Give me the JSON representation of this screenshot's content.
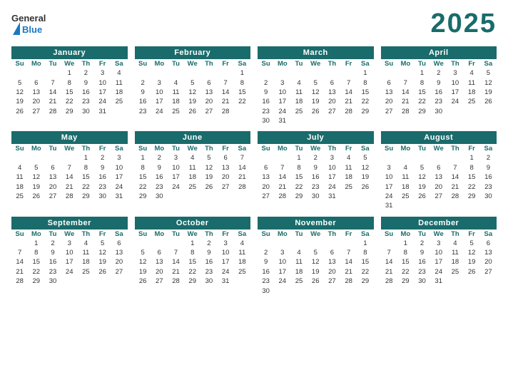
{
  "year": "2025",
  "logo": {
    "general": "General",
    "blue": "Blue"
  },
  "days_header": [
    "Su",
    "Mo",
    "Tu",
    "We",
    "Th",
    "Fr",
    "Sa"
  ],
  "months": [
    {
      "name": "January",
      "weeks": [
        [
          "",
          "",
          "",
          "1",
          "2",
          "3",
          "4"
        ],
        [
          "5",
          "6",
          "7",
          "8",
          "9",
          "10",
          "11"
        ],
        [
          "12",
          "13",
          "14",
          "15",
          "16",
          "17",
          "18"
        ],
        [
          "19",
          "20",
          "21",
          "22",
          "23",
          "24",
          "25"
        ],
        [
          "26",
          "27",
          "28",
          "29",
          "30",
          "31",
          ""
        ]
      ]
    },
    {
      "name": "February",
      "weeks": [
        [
          "",
          "",
          "",
          "",
          "",
          "",
          "1"
        ],
        [
          "2",
          "3",
          "4",
          "5",
          "6",
          "7",
          "8"
        ],
        [
          "9",
          "10",
          "11",
          "12",
          "13",
          "14",
          "15"
        ],
        [
          "16",
          "17",
          "18",
          "19",
          "20",
          "21",
          "22"
        ],
        [
          "23",
          "24",
          "25",
          "26",
          "27",
          "28",
          ""
        ]
      ]
    },
    {
      "name": "March",
      "weeks": [
        [
          "",
          "",
          "",
          "",
          "",
          "",
          "1"
        ],
        [
          "2",
          "3",
          "4",
          "5",
          "6",
          "7",
          "8"
        ],
        [
          "9",
          "10",
          "11",
          "12",
          "13",
          "14",
          "15"
        ],
        [
          "16",
          "17",
          "18",
          "19",
          "20",
          "21",
          "22"
        ],
        [
          "23",
          "24",
          "25",
          "26",
          "27",
          "28",
          "29"
        ],
        [
          "30",
          "31",
          "",
          "",
          "",
          "",
          ""
        ]
      ]
    },
    {
      "name": "April",
      "weeks": [
        [
          "",
          "",
          "1",
          "2",
          "3",
          "4",
          "5"
        ],
        [
          "6",
          "7",
          "8",
          "9",
          "10",
          "11",
          "12"
        ],
        [
          "13",
          "14",
          "15",
          "16",
          "17",
          "18",
          "19"
        ],
        [
          "20",
          "21",
          "22",
          "23",
          "24",
          "25",
          "26"
        ],
        [
          "27",
          "28",
          "29",
          "30",
          "",
          "",
          ""
        ]
      ]
    },
    {
      "name": "May",
      "weeks": [
        [
          "",
          "",
          "",
          "",
          "1",
          "2",
          "3"
        ],
        [
          "4",
          "5",
          "6",
          "7",
          "8",
          "9",
          "10"
        ],
        [
          "11",
          "12",
          "13",
          "14",
          "15",
          "16",
          "17"
        ],
        [
          "18",
          "19",
          "20",
          "21",
          "22",
          "23",
          "24"
        ],
        [
          "25",
          "26",
          "27",
          "28",
          "29",
          "30",
          "31"
        ]
      ]
    },
    {
      "name": "June",
      "weeks": [
        [
          "1",
          "2",
          "3",
          "4",
          "5",
          "6",
          "7"
        ],
        [
          "8",
          "9",
          "10",
          "11",
          "12",
          "13",
          "14"
        ],
        [
          "15",
          "16",
          "17",
          "18",
          "19",
          "20",
          "21"
        ],
        [
          "22",
          "23",
          "24",
          "25",
          "26",
          "27",
          "28"
        ],
        [
          "29",
          "30",
          "",
          "",
          "",
          "",
          ""
        ]
      ]
    },
    {
      "name": "July",
      "weeks": [
        [
          "",
          "",
          "1",
          "2",
          "3",
          "4",
          "5"
        ],
        [
          "6",
          "7",
          "8",
          "9",
          "10",
          "11",
          "12"
        ],
        [
          "13",
          "14",
          "15",
          "16",
          "17",
          "18",
          "19"
        ],
        [
          "20",
          "21",
          "22",
          "23",
          "24",
          "25",
          "26"
        ],
        [
          "27",
          "28",
          "29",
          "30",
          "31",
          "",
          ""
        ]
      ]
    },
    {
      "name": "August",
      "weeks": [
        [
          "",
          "",
          "",
          "",
          "",
          "1",
          "2"
        ],
        [
          "3",
          "4",
          "5",
          "6",
          "7",
          "8",
          "9"
        ],
        [
          "10",
          "11",
          "12",
          "13",
          "14",
          "15",
          "16"
        ],
        [
          "17",
          "18",
          "19",
          "20",
          "21",
          "22",
          "23"
        ],
        [
          "24",
          "25",
          "26",
          "27",
          "28",
          "29",
          "30"
        ],
        [
          "31",
          "",
          "",
          "",
          "",
          "",
          ""
        ]
      ]
    },
    {
      "name": "September",
      "weeks": [
        [
          "",
          "1",
          "2",
          "3",
          "4",
          "5",
          "6"
        ],
        [
          "7",
          "8",
          "9",
          "10",
          "11",
          "12",
          "13"
        ],
        [
          "14",
          "15",
          "16",
          "17",
          "18",
          "19",
          "20"
        ],
        [
          "21",
          "22",
          "23",
          "24",
          "25",
          "26",
          "27"
        ],
        [
          "28",
          "29",
          "30",
          "",
          "",
          "",
          ""
        ]
      ]
    },
    {
      "name": "October",
      "weeks": [
        [
          "",
          "",
          "",
          "1",
          "2",
          "3",
          "4"
        ],
        [
          "5",
          "6",
          "7",
          "8",
          "9",
          "10",
          "11"
        ],
        [
          "12",
          "13",
          "14",
          "15",
          "16",
          "17",
          "18"
        ],
        [
          "19",
          "20",
          "21",
          "22",
          "23",
          "24",
          "25"
        ],
        [
          "26",
          "27",
          "28",
          "29",
          "30",
          "31",
          ""
        ]
      ]
    },
    {
      "name": "November",
      "weeks": [
        [
          "",
          "",
          "",
          "",
          "",
          "",
          "1"
        ],
        [
          "2",
          "3",
          "4",
          "5",
          "6",
          "7",
          "8"
        ],
        [
          "9",
          "10",
          "11",
          "12",
          "13",
          "14",
          "15"
        ],
        [
          "16",
          "17",
          "18",
          "19",
          "20",
          "21",
          "22"
        ],
        [
          "23",
          "24",
          "25",
          "26",
          "27",
          "28",
          "29"
        ],
        [
          "30",
          "",
          "",
          "",
          "",
          "",
          ""
        ]
      ]
    },
    {
      "name": "December",
      "weeks": [
        [
          "",
          "1",
          "2",
          "3",
          "4",
          "5",
          "6"
        ],
        [
          "7",
          "8",
          "9",
          "10",
          "11",
          "12",
          "13"
        ],
        [
          "14",
          "15",
          "16",
          "17",
          "18",
          "19",
          "20"
        ],
        [
          "21",
          "22",
          "23",
          "24",
          "25",
          "26",
          "27"
        ],
        [
          "28",
          "29",
          "30",
          "31",
          "",
          "",
          ""
        ]
      ]
    }
  ]
}
